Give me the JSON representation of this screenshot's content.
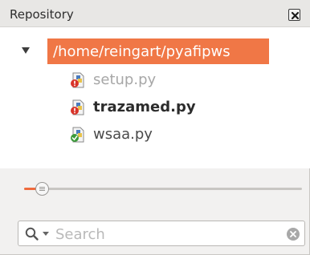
{
  "panel": {
    "title": "Repository",
    "close_icon": "close-icon"
  },
  "tree": {
    "root": {
      "label": "/home/reingart/pyafipws",
      "expanded": true
    },
    "files": [
      {
        "label": "setup.py",
        "state": "dimmed",
        "icon": "python-file-modified-icon"
      },
      {
        "label": "trazamed.py",
        "state": "bold",
        "icon": "python-file-modified-icon"
      },
      {
        "label": "wsaa.py",
        "state": "normal",
        "icon": "python-file-ok-icon"
      }
    ]
  },
  "slider": {
    "value": 0.04,
    "accent": "#ef6b3d"
  },
  "search": {
    "placeholder": "Search",
    "value": ""
  },
  "colors": {
    "selection": "#f07746",
    "panel_bg": "#f2f1f0"
  }
}
